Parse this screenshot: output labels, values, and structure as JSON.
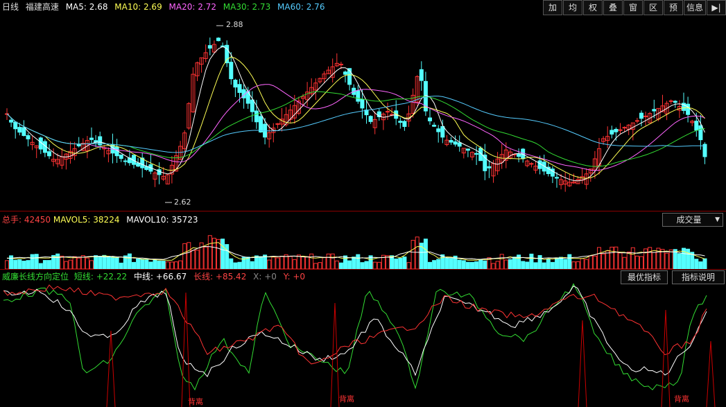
{
  "price_header": {
    "period": "日线",
    "stock": "福建高速",
    "ma": [
      {
        "label": "MA5: 2.68",
        "color": "#ffffff"
      },
      {
        "label": "MA10: 2.69",
        "color": "#ffff55"
      },
      {
        "label": "MA20: 2.72",
        "color": "#ff66ff"
      },
      {
        "label": "MA30: 2.73",
        "color": "#33dd33"
      },
      {
        "label": "MA60: 2.76",
        "color": "#55ccff"
      }
    ]
  },
  "toolbar": [
    "加",
    "均",
    "权",
    "叠",
    "窗",
    "区",
    "预",
    "信息",
    "▶|"
  ],
  "annotations": {
    "high": "2.88",
    "low": "2.62"
  },
  "volume_header": {
    "total_label": "总手: ",
    "total_value": "42450",
    "mavol5": "MAVOL5: 38224",
    "mavol10": "MAVOL10: 35723",
    "dropdown": "成交量",
    "dropdown_arrow": "▼"
  },
  "indicator_header": {
    "name": "威廉长线方向定位",
    "short": "短线: +22.22",
    "mid": "中线: +66.67",
    "long": "长线: +85.42",
    "x": "X: +0",
    "y": "Y: +0",
    "best_button": "最优指标",
    "help_button": "指标说明"
  },
  "divergence_labels": [
    "背离",
    "背离",
    "背离"
  ],
  "colors": {
    "up": "#ff3333",
    "down": "#54ffff",
    "border": "#8b0000"
  }
}
